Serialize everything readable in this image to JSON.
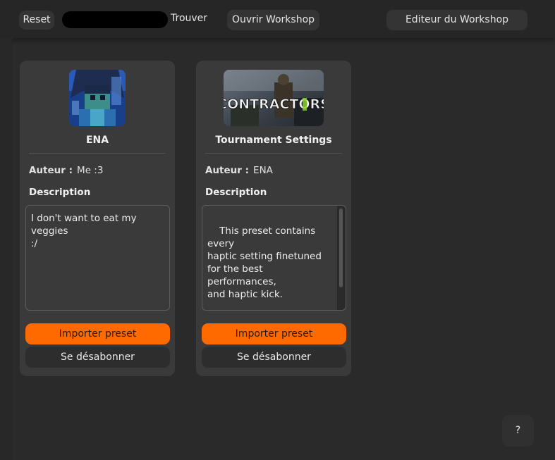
{
  "toolbar": {
    "reset_label": "Reset",
    "search_value": "",
    "find_label": "Trouver",
    "open_workshop_label": "Ouvrir Workshop",
    "editor_label": "Editeur du Workshop"
  },
  "labels": {
    "author": "Auteur :",
    "description": "Description",
    "import": "Importer preset",
    "unsubscribe": "Se désabonner"
  },
  "presets": [
    {
      "title": "ENA",
      "author": "Me :3",
      "description": "I don't want to eat my\nveggies\n:/",
      "thumbnail": "ena-avatar-image"
    },
    {
      "title": "Tournament Settings",
      "author": "ENA",
      "description": "This preset contains every\nhaptic setting finetuned\nfor the best performances,\nand haptic kick.\n\n- Spammy pickup is gone\n- Highest kick does not\ninterfere with scoping",
      "thumbnail": "contractors-game-image",
      "thumbnail_text": "CONTRACTORS"
    }
  ],
  "help_label": "?",
  "colors": {
    "accent": "#ff6a00",
    "background": "#2a2a2a",
    "card": "#3a3a3a"
  }
}
